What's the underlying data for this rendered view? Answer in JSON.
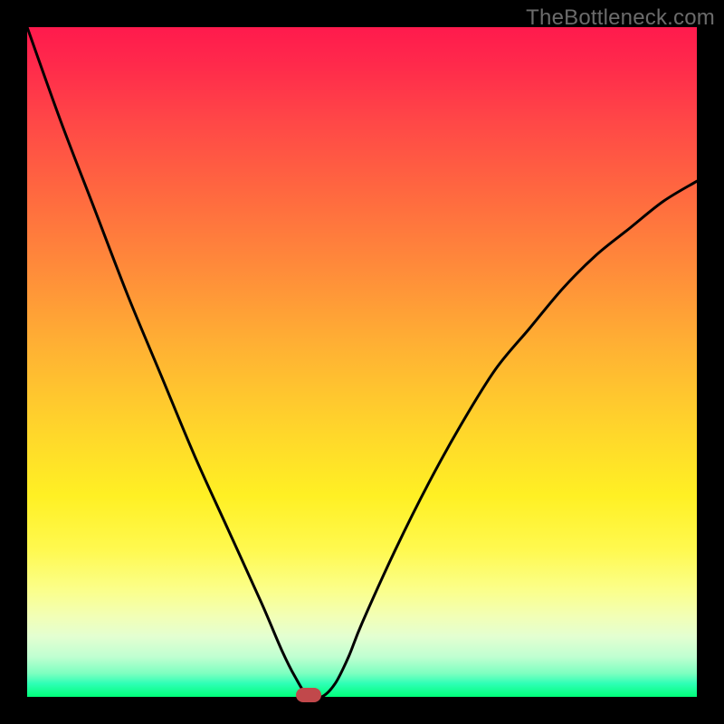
{
  "watermark": {
    "text": "TheBottleneck.com"
  },
  "colors": {
    "curve_stroke": "#000000",
    "frame": "#000000",
    "marker_fill": "#c1484b"
  },
  "chart_data": {
    "type": "line",
    "title": "",
    "xlabel": "",
    "ylabel": "",
    "xlim": [
      0,
      1
    ],
    "ylim": [
      0,
      1
    ],
    "grid": false,
    "legend": false,
    "series": [
      {
        "name": "bottleneck-curve",
        "x": [
          0.0,
          0.05,
          0.1,
          0.15,
          0.2,
          0.25,
          0.3,
          0.35,
          0.38,
          0.4,
          0.42,
          0.44,
          0.46,
          0.48,
          0.5,
          0.55,
          0.6,
          0.65,
          0.7,
          0.75,
          0.8,
          0.85,
          0.9,
          0.95,
          1.0
        ],
        "y": [
          1.0,
          0.86,
          0.73,
          0.6,
          0.48,
          0.36,
          0.25,
          0.14,
          0.07,
          0.03,
          0.0,
          0.0,
          0.02,
          0.06,
          0.11,
          0.22,
          0.32,
          0.41,
          0.49,
          0.55,
          0.61,
          0.66,
          0.7,
          0.74,
          0.77
        ]
      }
    ],
    "marker": {
      "x": 0.42,
      "y": 0.0
    }
  }
}
